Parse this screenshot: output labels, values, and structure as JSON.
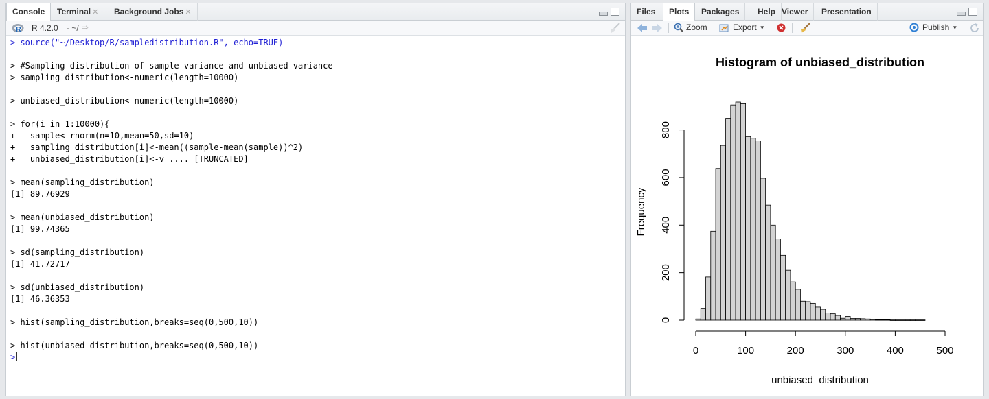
{
  "left_pane": {
    "tabs": [
      {
        "label": "Console",
        "closable": false
      },
      {
        "label": "Terminal",
        "closable": true
      },
      {
        "label": "Background Jobs",
        "closable": true
      }
    ],
    "r_version": "R 4.2.0",
    "path": "· ~/",
    "console_lines": [
      {
        "type": "cmd",
        "text": "> source(\"~/Desktop/R/sampledistribution.R\", echo=TRUE)"
      },
      {
        "type": "blank",
        "text": ""
      },
      {
        "type": "out",
        "text": "> #Sampling distribution of sample variance and unbiased variance"
      },
      {
        "type": "out",
        "text": "> sampling_distribution<-numeric(length=10000)"
      },
      {
        "type": "blank",
        "text": ""
      },
      {
        "type": "out",
        "text": "> unbiased_distribution<-numeric(length=10000)"
      },
      {
        "type": "blank",
        "text": ""
      },
      {
        "type": "out",
        "text": "> for(i in 1:10000){"
      },
      {
        "type": "out",
        "text": "+   sample<-rnorm(n=10,mean=50,sd=10)"
      },
      {
        "type": "out",
        "text": "+   sampling_distribution[i]<-mean((sample-mean(sample))^2)"
      },
      {
        "type": "out",
        "text": "+   unbiased_distribution[i]<-v .... [TRUNCATED]"
      },
      {
        "type": "blank",
        "text": ""
      },
      {
        "type": "out",
        "text": "> mean(sampling_distribution)"
      },
      {
        "type": "out",
        "text": "[1] 89.76929"
      },
      {
        "type": "blank",
        "text": ""
      },
      {
        "type": "out",
        "text": "> mean(unbiased_distribution)"
      },
      {
        "type": "out",
        "text": "[1] 99.74365"
      },
      {
        "type": "blank",
        "text": ""
      },
      {
        "type": "out",
        "text": "> sd(sampling_distribution)"
      },
      {
        "type": "out",
        "text": "[1] 41.72717"
      },
      {
        "type": "blank",
        "text": ""
      },
      {
        "type": "out",
        "text": "> sd(unbiased_distribution)"
      },
      {
        "type": "out",
        "text": "[1] 46.36353"
      },
      {
        "type": "blank",
        "text": ""
      },
      {
        "type": "out",
        "text": "> hist(sampling_distribution,breaks=seq(0,500,10))"
      },
      {
        "type": "blank",
        "text": ""
      },
      {
        "type": "out",
        "text": "> hist(unbiased_distribution,breaks=seq(0,500,10))"
      }
    ],
    "prompt": ">"
  },
  "right_pane": {
    "tabs": [
      "Files",
      "Plots",
      "Packages",
      "Help",
      "Viewer",
      "Presentation"
    ],
    "active_tab": "Plots",
    "toolbar": {
      "zoom": "Zoom",
      "export": "Export",
      "publish": "Publish"
    }
  },
  "colors": {
    "prompt_blue": "#1f1fd4",
    "bar_fill": "#d3d3d3"
  },
  "chart_data": {
    "type": "bar",
    "title": "Histogram of unbiased_distribution",
    "xlabel": "unbiased_distribution",
    "ylabel": "Frequency",
    "bin_width": 10,
    "x_start": 0,
    "values": [
      5,
      50,
      182,
      374,
      638,
      735,
      849,
      905,
      917,
      913,
      772,
      765,
      754,
      597,
      484,
      400,
      342,
      273,
      210,
      161,
      130,
      80,
      78,
      71,
      55,
      46,
      30,
      27,
      20,
      8,
      16,
      7,
      7,
      6,
      5,
      3,
      2,
      2,
      2,
      1,
      1,
      1,
      1,
      1,
      1,
      1,
      0,
      0,
      0,
      0
    ],
    "xlim": [
      0,
      500
    ],
    "ylim": [
      0,
      917
    ],
    "x_ticks": [
      0,
      100,
      200,
      300,
      400,
      500
    ],
    "y_ticks": [
      0,
      200,
      400,
      600,
      800
    ]
  }
}
